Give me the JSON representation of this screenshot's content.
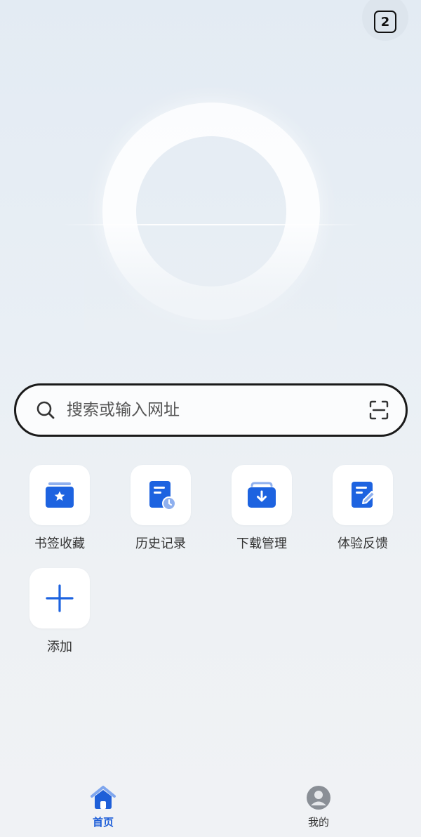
{
  "tabs": {
    "count": "2"
  },
  "search": {
    "placeholder": "搜索或输入网址"
  },
  "shortcuts": [
    {
      "label": "书签收藏",
      "icon": "bookmark-star-icon"
    },
    {
      "label": "历史记录",
      "icon": "history-clock-icon"
    },
    {
      "label": "下载管理",
      "icon": "download-icon"
    },
    {
      "label": "体验反馈",
      "icon": "feedback-edit-icon"
    },
    {
      "label": "添加",
      "icon": "plus-icon"
    }
  ],
  "nav": {
    "home_label": "首页",
    "profile_label": "我的"
  },
  "colors": {
    "accent": "#1e5fd8",
    "icon_blue": "#1d63e0"
  }
}
